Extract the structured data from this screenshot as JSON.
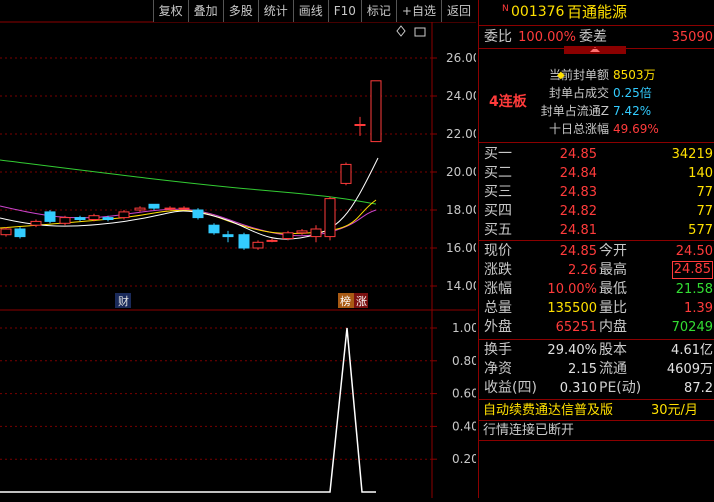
{
  "toolbar": {
    "buttons": [
      "复权",
      "叠加",
      "多股",
      "统计",
      "画线",
      "F10",
      "标记",
      "+自选",
      "返回"
    ]
  },
  "chart": {
    "price_ticks": [
      "26.00",
      "24.00",
      "22.00",
      "20.00",
      "18.00",
      "16.00",
      "14.00"
    ],
    "volume_ticks": [
      "1.00",
      "0.80",
      "0.60",
      "0.40",
      "0.20"
    ],
    "badge_cai": "财",
    "badge_bang": "榜",
    "badge_zhang": "涨",
    "board_label": "4连板"
  },
  "stock": {
    "badge": "N",
    "code": "001376",
    "name": "百通能源"
  },
  "weibi": {
    "label1": "委比",
    "value1": "100.00%",
    "label2": "委差",
    "value2": "35090"
  },
  "seal": {
    "rows": [
      {
        "label": "当前封单额",
        "value": "8503万",
        "color": "#ffe000"
      },
      {
        "label": "封单占成交",
        "value": "0.25倍",
        "color": "#33ccff"
      },
      {
        "label": "封单占流通Z",
        "value": "7.42%",
        "color": "#33ccff"
      },
      {
        "label": "十日总涨幅",
        "value": "49.69%",
        "color": "#ff3b3b"
      }
    ]
  },
  "orders": [
    {
      "label": "买一",
      "price": "24.85",
      "vol": "34219",
      "volColor": "#ffe000"
    },
    {
      "label": "买二",
      "price": "24.84",
      "vol": "140",
      "volColor": "#ffe000"
    },
    {
      "label": "买三",
      "price": "24.83",
      "vol": "77",
      "volColor": "#ffe000"
    },
    {
      "label": "买四",
      "price": "24.82",
      "vol": "77",
      "volColor": "#ffe000"
    },
    {
      "label": "买五",
      "price": "24.81",
      "vol": "577",
      "volColor": "#ffe000"
    }
  ],
  "quote": {
    "xianjia_label": "现价",
    "xianjia": "24.85",
    "jinkai_label": "今开",
    "jinkai": "24.50",
    "zhangdie_label": "涨跌",
    "zhangdie": "2.26",
    "zuigao_label": "最高",
    "zuigao": "24.85",
    "zhangfu_label": "涨幅",
    "zhangfu": "10.00%",
    "zuidi_label": "最低",
    "zuidi": "21.58",
    "zongliang_label": "总量",
    "zongliang": "135500",
    "liangbi_label": "量比",
    "liangbi": "1.39",
    "waipan_label": "外盘",
    "waipan": "65251",
    "neipan_label": "内盘",
    "neipan": "70249"
  },
  "fund": {
    "huanshou_label": "换手",
    "huanshou": "29.40%",
    "guben_label": "股本",
    "guben": "4.61亿",
    "jingzi_label": "净资",
    "jingzi": "2.15",
    "liutong_label": "流通",
    "liutong": "4609万",
    "shouyi_label": "收益(四)",
    "shouyi": "0.310",
    "pe_label": "PE(动)",
    "pe": "87.2"
  },
  "promo": {
    "text": "自动续费通达信普及版",
    "price": "30元/月"
  },
  "status": "行情连接已断开",
  "colors": {
    "up": "#ff3b3b",
    "down": "#33dd33",
    "border": "#8b0000"
  }
}
